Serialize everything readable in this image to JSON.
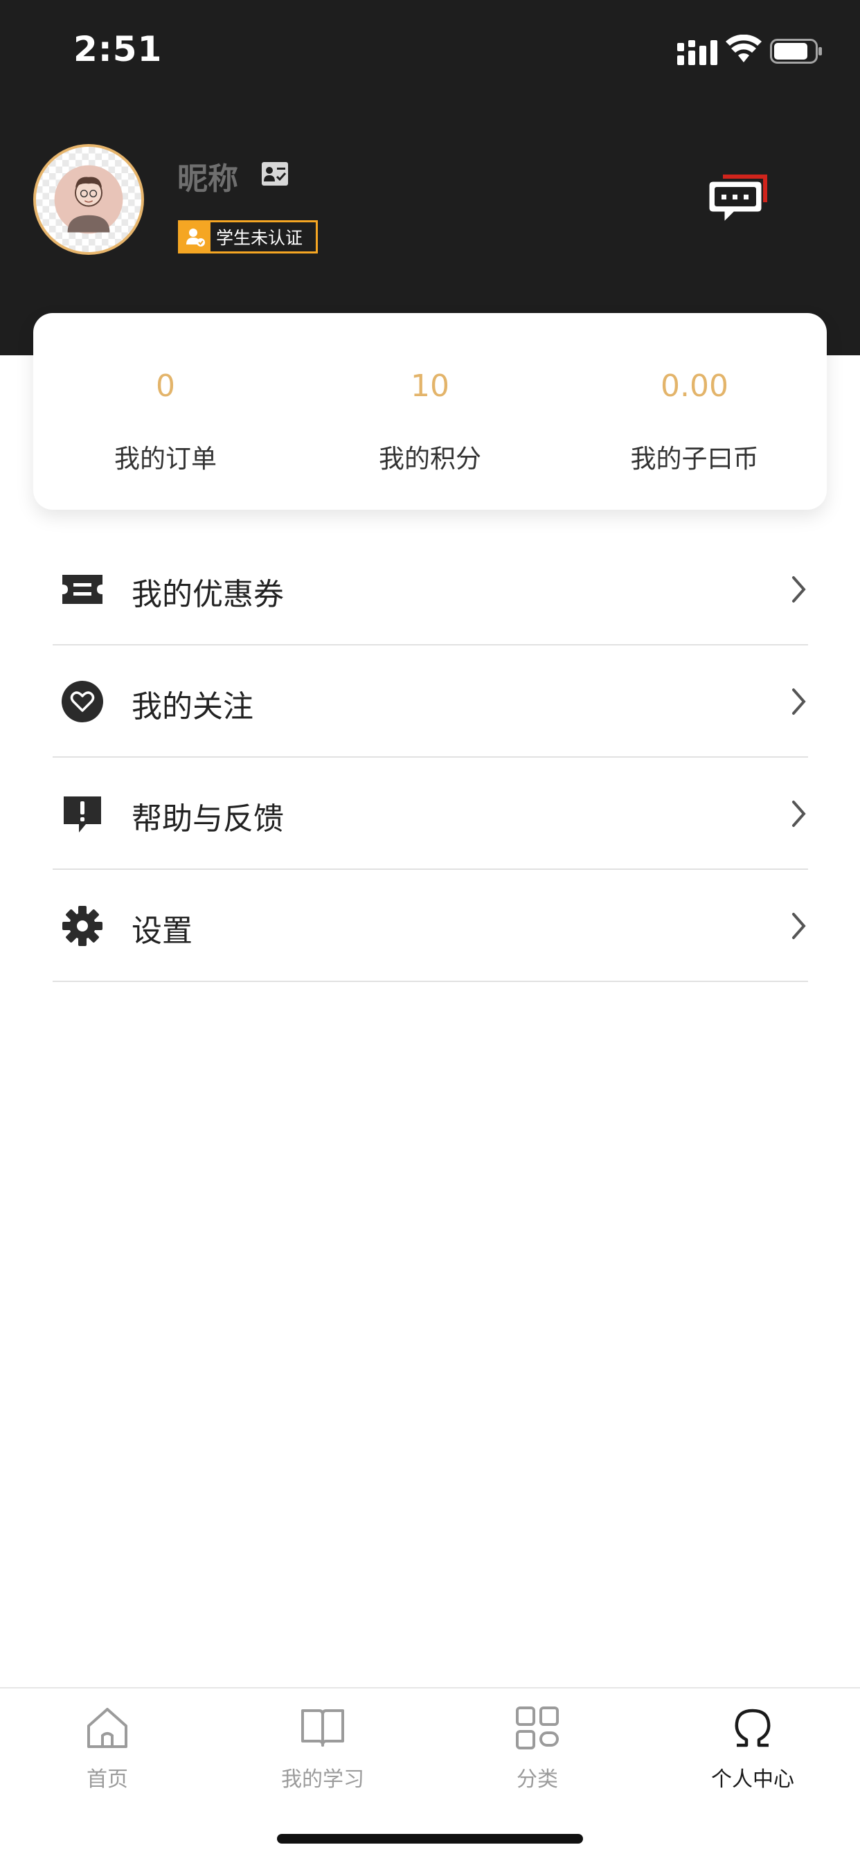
{
  "status_bar": {
    "time": "2:51"
  },
  "profile": {
    "nickname": "昵称",
    "student_badge": "学生未认证",
    "icons": {
      "avatar": "avatar-boy",
      "edit": "id-card-icon",
      "message": "chat-bubble-icon"
    }
  },
  "stats": [
    {
      "value": "0",
      "label": "我的订单"
    },
    {
      "value": "10",
      "label": "我的积分"
    },
    {
      "value": "0.00",
      "label": "我的子曰币"
    }
  ],
  "menu": [
    {
      "label": "我的优惠券",
      "icon": "ticket-icon"
    },
    {
      "label": "我的关注",
      "icon": "heart-icon"
    },
    {
      "label": "帮助与反馈",
      "icon": "feedback-icon"
    },
    {
      "label": "设置",
      "icon": "gear-icon"
    }
  ],
  "tabs": [
    {
      "label": "首页",
      "icon": "home-icon",
      "active": false
    },
    {
      "label": "我的学习",
      "icon": "book-icon",
      "active": false
    },
    {
      "label": "分类",
      "icon": "grid-icon",
      "active": false
    },
    {
      "label": "个人中心",
      "icon": "omega-icon",
      "active": true
    }
  ],
  "colors": {
    "header_bg": "#1e1e1e",
    "accent_gold": "#e3b46a",
    "badge_orange": "#f5a623",
    "message_red": "#d0241c"
  }
}
